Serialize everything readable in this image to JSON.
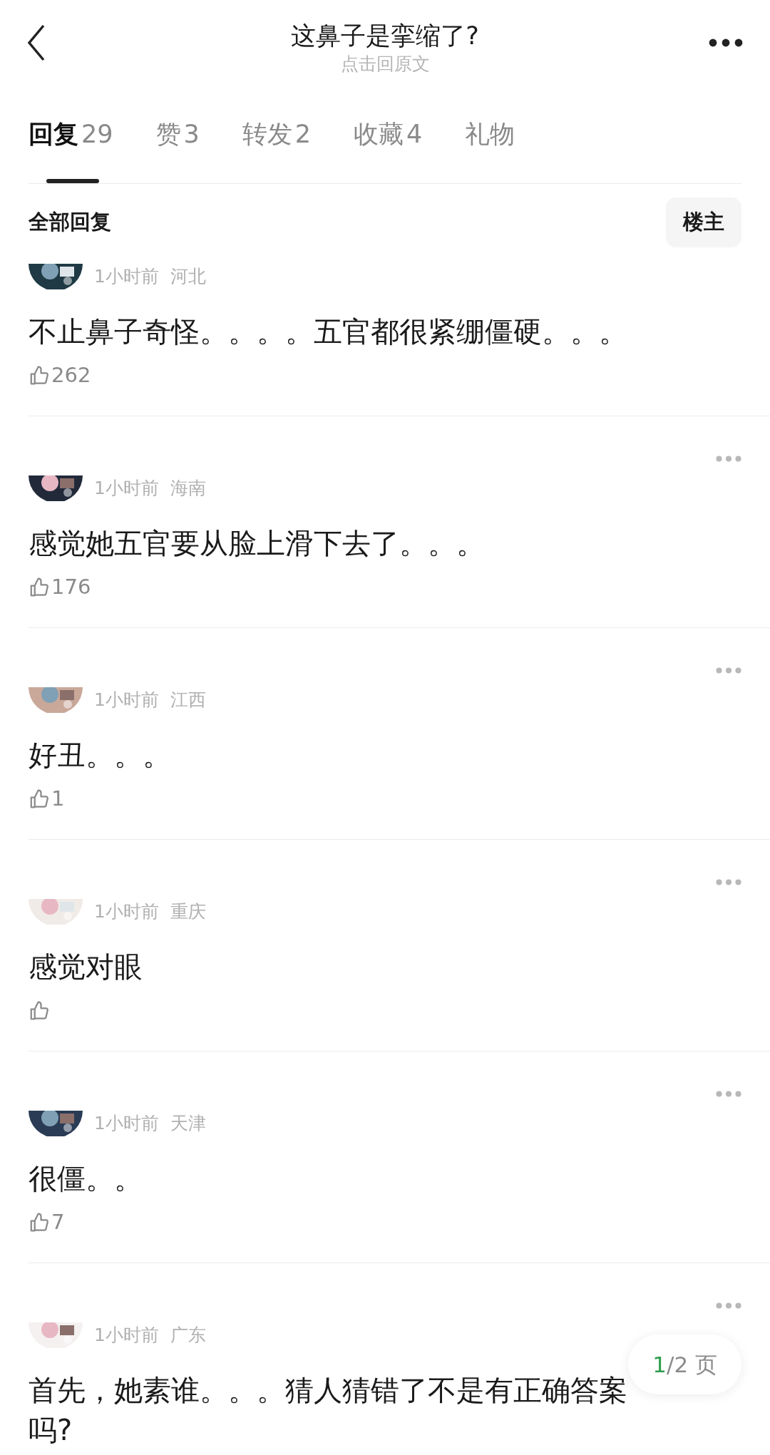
{
  "header": {
    "title": "这鼻子是挛缩了?",
    "subtitle": "点击回原文"
  },
  "tabs": [
    {
      "label": "回复",
      "count": "29",
      "selected": true
    },
    {
      "label": "赞",
      "count": "3",
      "selected": false
    },
    {
      "label": "转发",
      "count": "2",
      "selected": false
    },
    {
      "label": "收藏",
      "count": "4",
      "selected": false
    },
    {
      "label": "礼物",
      "selected": false
    }
  ],
  "section": {
    "title": "全部回复",
    "filter_button": "楼主"
  },
  "comments": [
    {
      "time": "1小时前",
      "location": "河北",
      "text": "不止鼻子奇怪。。。。五官都很紧绷僵硬。。。",
      "likes": "262",
      "menu": false
    },
    {
      "time": "1小时前",
      "location": "海南",
      "text": "感觉她五官要从脸上滑下去了。。。",
      "likes": "176",
      "menu": true
    },
    {
      "time": "1小时前",
      "location": "江西",
      "text": "好丑。。。",
      "likes": "1",
      "menu": true
    },
    {
      "time": "1小时前",
      "location": "重庆",
      "text": "感觉对眼",
      "menu": true
    },
    {
      "time": "1小时前",
      "location": "天津",
      "text": "很僵。。",
      "likes": "7",
      "menu": true
    },
    {
      "time": "1小时前",
      "location": "广东",
      "text": "首先，她素谁。。。猜人猜错了不是有正确答案吗?",
      "menu": true
    }
  ],
  "pager": {
    "current": "1",
    "rest": "/2 页"
  }
}
